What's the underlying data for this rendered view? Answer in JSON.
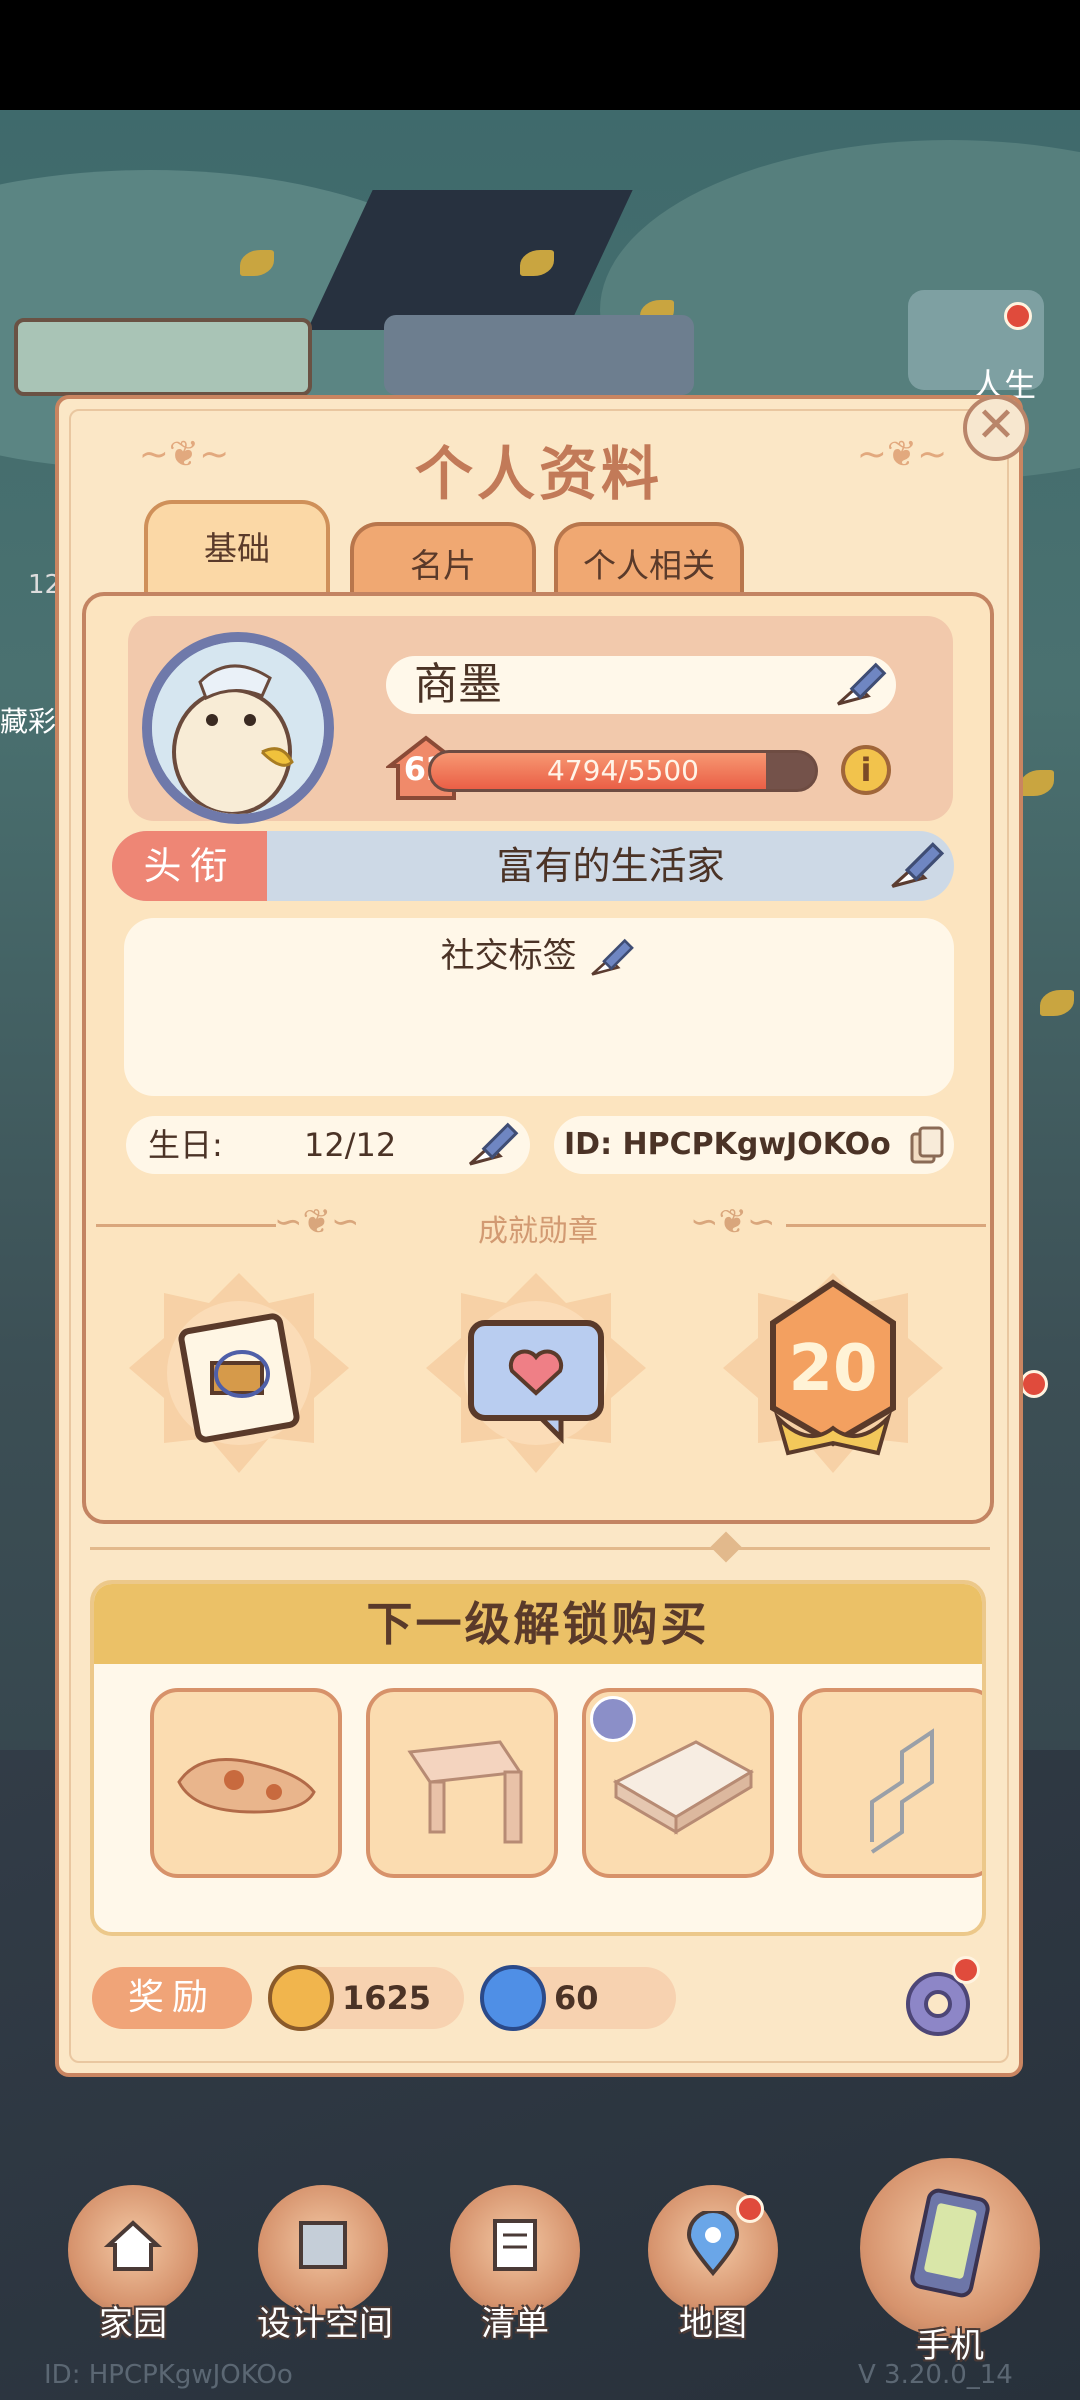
{
  "panel": {
    "title": "个人资料",
    "close_glyph": "✕"
  },
  "tabs": [
    {
      "label": "基础",
      "active": true
    },
    {
      "label": "名片",
      "active": false
    },
    {
      "label": "个人相关",
      "active": false
    }
  ],
  "profile": {
    "name": "商墨",
    "level": "62",
    "xp_text": "4794/5500",
    "xp_current": 4794,
    "xp_max": 5500,
    "info_glyph": "i",
    "title_label": "头衔",
    "title_value": "富有的生活家",
    "social_label": "社交标签",
    "birthday_label": "生日:",
    "birthday_value": "12/12",
    "id_text": "ID: HPCPKgwJOKOo"
  },
  "achievements": {
    "title": "成就勋章",
    "badges": [
      {
        "icon": "scroll-badge-icon"
      },
      {
        "icon": "heart-bubble-badge-icon"
      },
      {
        "icon": "number-badge-icon",
        "number": "20"
      }
    ]
  },
  "unlock": {
    "title": "下一级解锁购买",
    "items": [
      {
        "icon": "cat-rug-icon"
      },
      {
        "icon": "table-icon"
      },
      {
        "icon": "sofa-icon",
        "tag": "furniture-set-tag-icon"
      },
      {
        "icon": "rack-icon"
      }
    ]
  },
  "rewards": {
    "label": "奖励",
    "coins": "1625",
    "gems": "60"
  },
  "nav": [
    {
      "label": "家园",
      "icon": "home-icon"
    },
    {
      "label": "设计空间",
      "icon": "design-icon"
    },
    {
      "label": "清单",
      "icon": "list-icon"
    },
    {
      "label": "地图",
      "icon": "map-pin-icon"
    },
    {
      "label": "手机",
      "icon": "phone-icon"
    }
  ],
  "footer": {
    "player_id": "ID: HPCPKgwJOKOo",
    "version": "V 3.20.0_14"
  },
  "background_labels": {
    "left_side": "藏彩",
    "left_number": "12",
    "right_top": "人生"
  },
  "colors": {
    "panel_bg": "#fbe7c6",
    "accent_orange": "#ee8675",
    "title_bar": "#cdd9e6",
    "unlock_header": "#ebc167"
  }
}
